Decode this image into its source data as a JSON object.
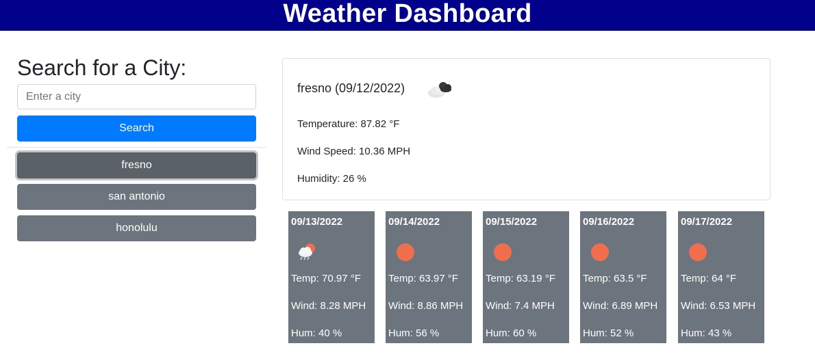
{
  "header": {
    "title": "Weather Dashboard"
  },
  "sidebar": {
    "title": "Search for a City:",
    "input_placeholder": "Enter a city",
    "input_value": "",
    "search_label": "Search",
    "history": [
      "fresno",
      "san antonio",
      "honolulu"
    ]
  },
  "current": {
    "title": "fresno (09/12/2022)",
    "icon": "broken-clouds-icon",
    "temperature": "Temperature: 87.82 °F",
    "wind": "Wind Speed: 10.36 MPH",
    "humidity": "Humidity: 26 %"
  },
  "forecast": [
    {
      "date": "09/13/2022",
      "icon": "sun-rain-cloud-icon",
      "temp": "Temp: 70.97 °F",
      "wind": "Wind: 8.28 MPH",
      "hum": "Hum: 40 %"
    },
    {
      "date": "09/14/2022",
      "icon": "sun-icon",
      "temp": "Temp: 63.97 °F",
      "wind": "Wind: 8.86 MPH",
      "hum": "Hum: 56 %"
    },
    {
      "date": "09/15/2022",
      "icon": "sun-icon",
      "temp": "Temp: 63.19 °F",
      "wind": "Wind: 7.4 MPH",
      "hum": "Hum: 60 %"
    },
    {
      "date": "09/16/2022",
      "icon": "sun-icon",
      "temp": "Temp: 63.5 °F",
      "wind": "Wind: 6.89 MPH",
      "hum": "Hum: 52 %"
    },
    {
      "date": "09/17/2022",
      "icon": "sun-icon",
      "temp": "Temp: 64 °F",
      "wind": "Wind: 6.53 MPH",
      "hum": "Hum: 43 %"
    }
  ],
  "colors": {
    "header": "#00008b",
    "primary": "#007bff",
    "secondary": "#6c757d",
    "sun": "#ee6e4d"
  }
}
